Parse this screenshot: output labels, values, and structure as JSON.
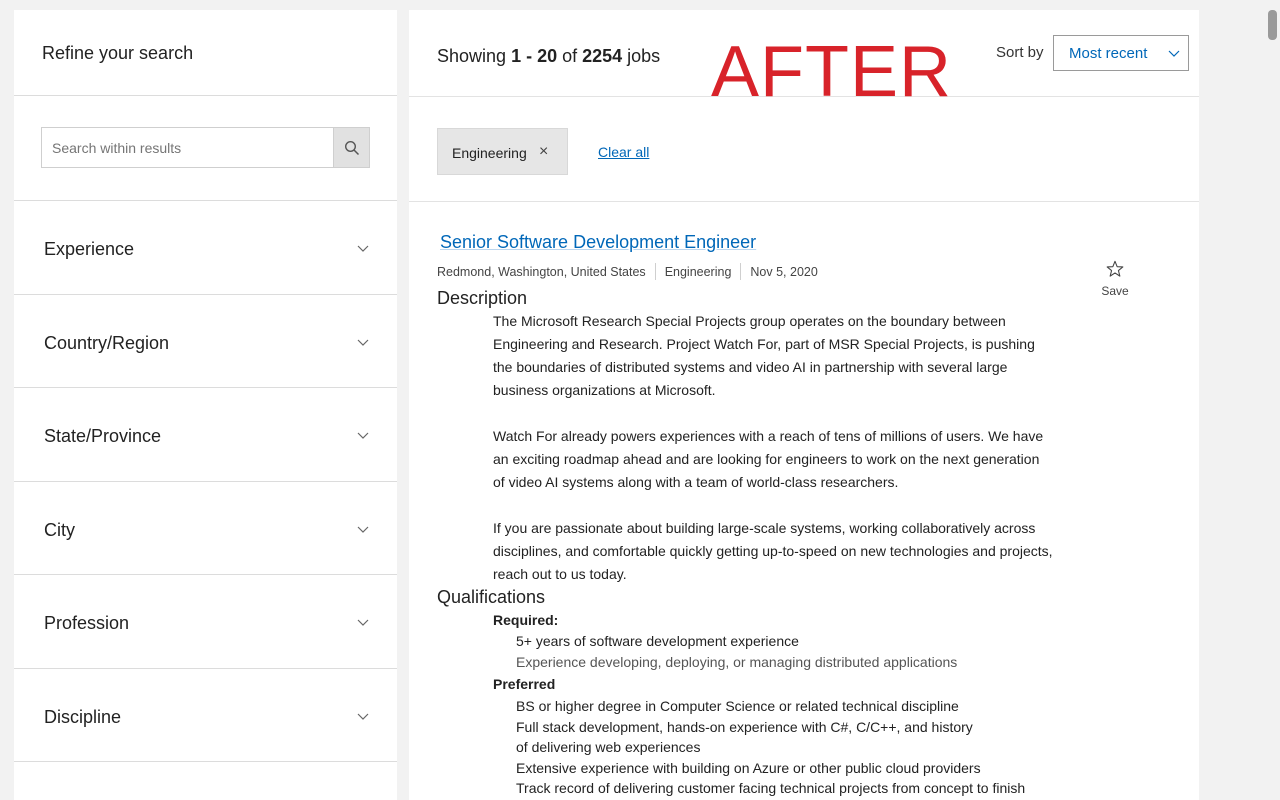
{
  "sidebar": {
    "title": "Refine your search",
    "search_placeholder": "Search within results",
    "filters": [
      {
        "label": "Experience"
      },
      {
        "label": "Country/Region"
      },
      {
        "label": "State/Province"
      },
      {
        "label": "City"
      },
      {
        "label": "Profession"
      },
      {
        "label": "Discipline"
      }
    ]
  },
  "results": {
    "showing_prefix": "Showing ",
    "range": "1 - 20",
    "of": " of ",
    "total": "2254",
    "suffix": " jobs",
    "stamp": "AFTER",
    "sort_label": "Sort by",
    "sort_value": "Most recent",
    "chip_label": "Engineering",
    "chip_remove": "×",
    "clear_all": "Clear all"
  },
  "job": {
    "title": "Senior Software Development Engineer",
    "location": "Redmond, Washington, United States",
    "discipline": "Engineering",
    "date": "Nov 5, 2020",
    "save_label": "Save",
    "description_heading": "Description",
    "description": [
      "The Microsoft Research Special Projects group operates on the boundary between Engineering and Research.  Project Watch For, part of MSR Special Projects, is pushing the boundaries of distributed systems and video AI in partnership with several large business organizations at Microsoft.",
      "Watch For already powers experiences with a reach of tens of millions of users. We have an exciting roadmap ahead and are looking for engineers to work on the next generation of video AI systems along with a team of world-class researchers.",
      "If you are passionate about building large-scale systems, working collaboratively across disciplines, and comfortable quickly getting up-to-speed on new technologies and projects, reach out to us today."
    ],
    "qualifications_heading": "Qualifications",
    "required_heading": "Required:",
    "required": [
      "5+ years of software development experience",
      "Experience developing, deploying, or managing distributed applications"
    ],
    "preferred_heading": "Preferred",
    "preferred": [
      "BS or higher degree in Computer Science or related technical discipline",
      "Full stack development, hands-on experience with C#, C/C++, and history of delivering web experiences",
      "Extensive experience with building on Azure or other public cloud providers",
      "Track record of delivering customer facing technical projects from concept to finish"
    ]
  },
  "colors": {
    "link": "#0067b8",
    "stamp": "#d8232a",
    "panel": "#ffffff",
    "background": "#f2f2f2"
  },
  "icons": [
    "search-icon",
    "chevron-down-icon",
    "close-icon",
    "star-icon"
  ]
}
